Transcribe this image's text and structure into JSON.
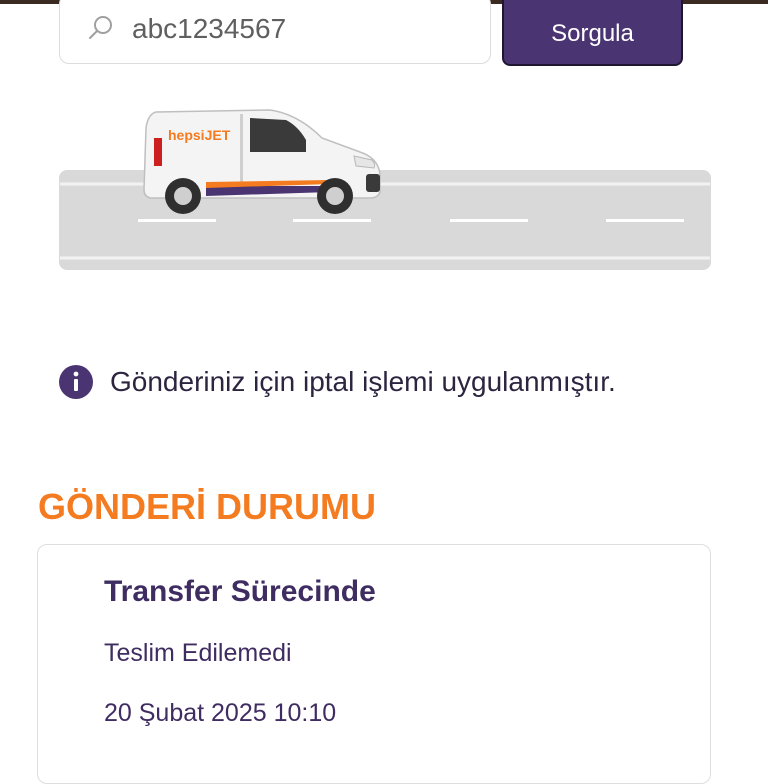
{
  "search": {
    "value": "abc1234567",
    "icon": "search-icon",
    "button_label": "Sorgula"
  },
  "banner": {
    "vehicle_brand": "hepsiJET",
    "icon": "delivery-van-illustration"
  },
  "notice": {
    "icon": "info-icon",
    "text": "Gönderiniz için iptal işlemi uygulanmıştır."
  },
  "section": {
    "title": "GÖNDERİ DURUMU"
  },
  "status": {
    "title": "Transfer Sürecinde",
    "subtitle": "Teslim Edilemedi",
    "datetime": "20 Şubat 2025 10:10"
  },
  "colors": {
    "primary": "#4a3471",
    "accent": "#f47b20",
    "text": "#3f2d62",
    "road": "#d9d9d9"
  }
}
